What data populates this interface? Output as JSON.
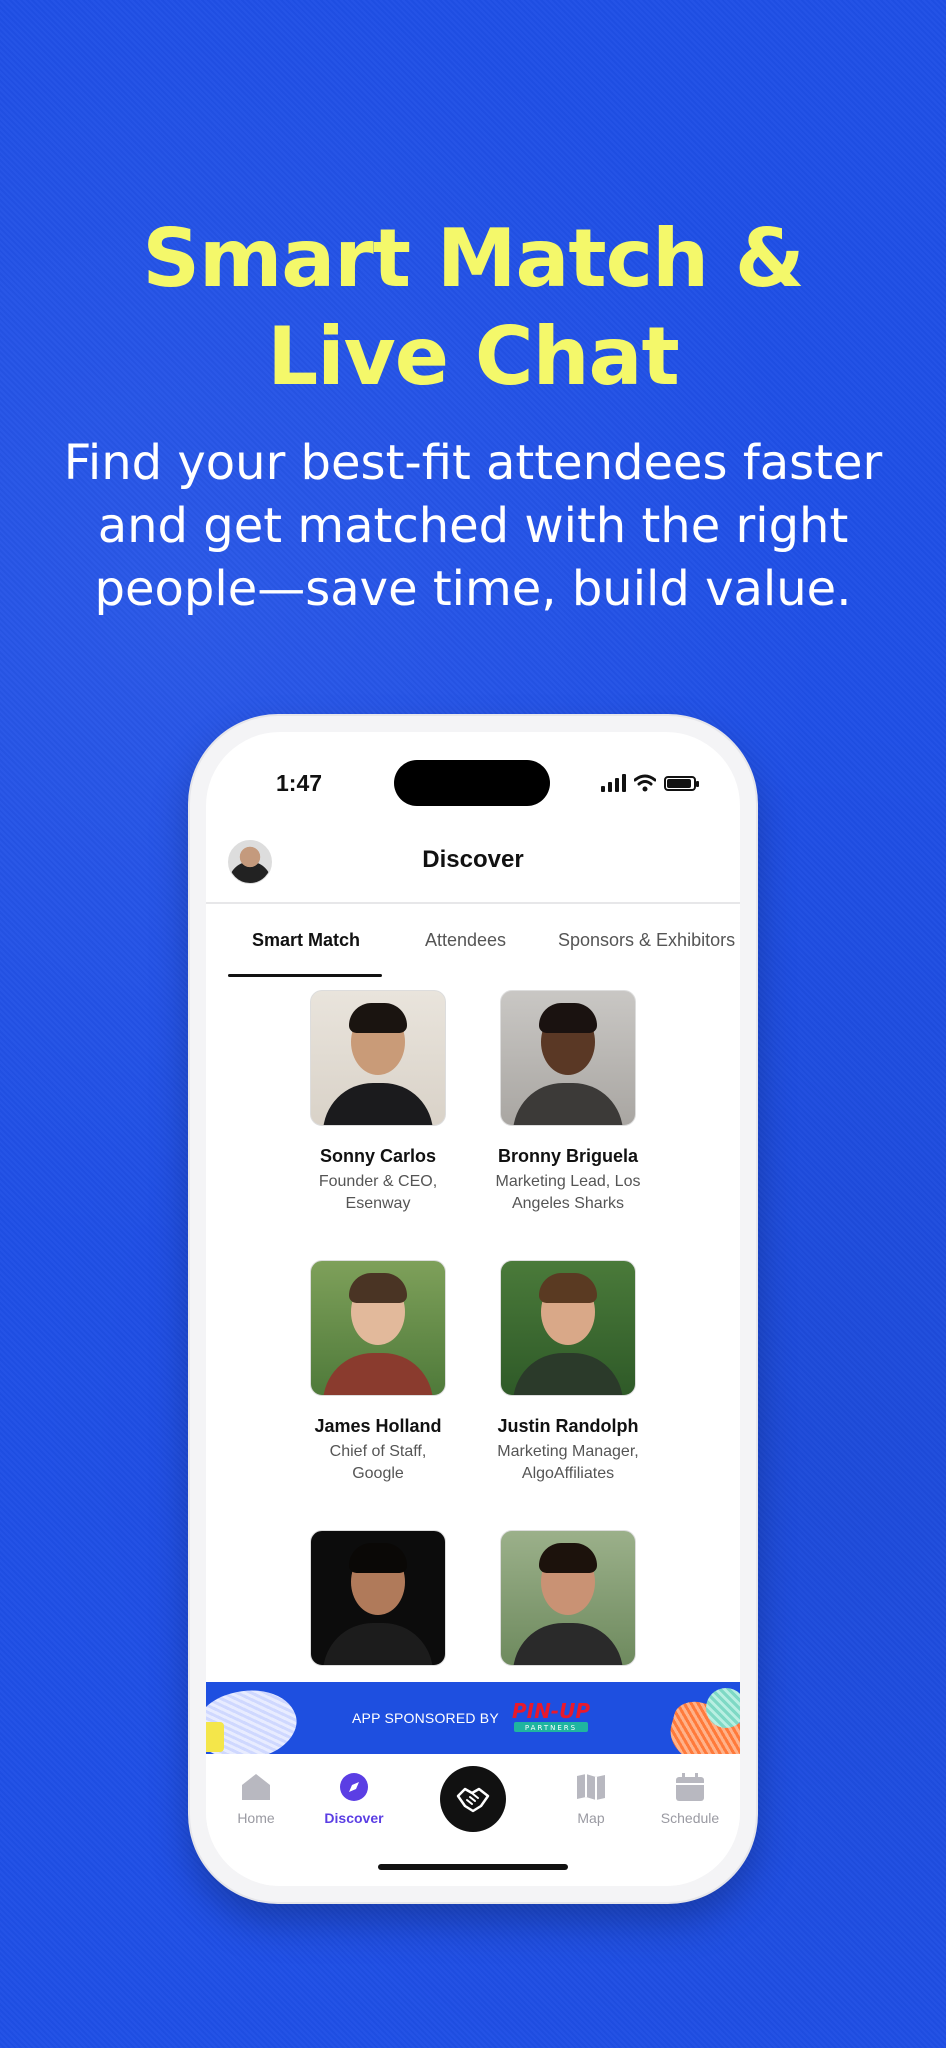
{
  "hero": {
    "title_line1": "Smart Match &",
    "title_line2": "Live Chat",
    "subtitle_line1": "Find your best-fit attendees faster",
    "subtitle_line2": "and get matched with the right",
    "subtitle_line3": "people—save time, build value."
  },
  "status_bar": {
    "time": "1:47"
  },
  "header": {
    "title": "Discover",
    "avatar_icon": "user-avatar"
  },
  "tabs": [
    {
      "label": "Smart Match",
      "active": true
    },
    {
      "label": "Attendees",
      "active": false
    },
    {
      "label": "Sponsors & Exhibitors",
      "active": false
    }
  ],
  "people": [
    {
      "name": "Sonny Carlos",
      "role": "Founder & CEO, Esenway"
    },
    {
      "name": "Bronny Briguela",
      "role": "Marketing Lead, Los Angeles Sharks"
    },
    {
      "name": "James Holland",
      "role": "Chief of Staff, Google"
    },
    {
      "name": "Justin Randolph",
      "role": "Marketing Manager, AlgoAffiliates"
    },
    {
      "name": "",
      "role": ""
    },
    {
      "name": "",
      "role": ""
    }
  ],
  "sponsor": {
    "text": "APP SPONSORED BY",
    "logo_text": "PIN-UP",
    "logo_sub": "PARTNERS"
  },
  "nav": {
    "home": "Home",
    "discover": "Discover",
    "map": "Map",
    "schedule": "Schedule",
    "center_icon": "handshake-icon"
  },
  "colors": {
    "background": "#1f4fe6",
    "headline": "#f4f86a",
    "accent": "#5b3ee4"
  }
}
